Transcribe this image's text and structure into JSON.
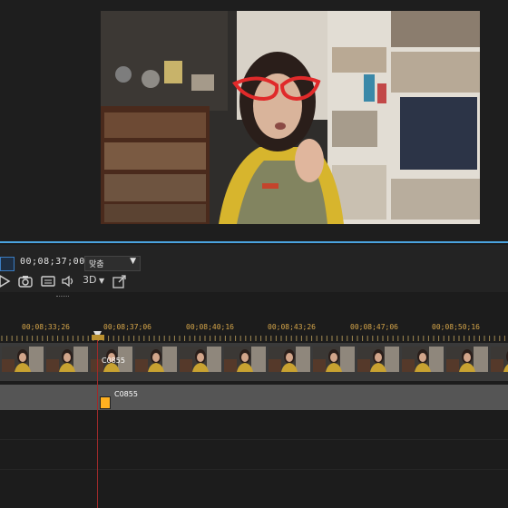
{
  "player": {
    "timecode": "00;08;37;00",
    "fit_label": "맞춤",
    "mode_3d": "3D"
  },
  "icons": [
    "play-icon",
    "camera-icon",
    "subtitle-icon",
    "speaker-icon",
    "external-link-icon",
    "chevron-down-icon"
  ],
  "timeline": {
    "ruler_labels": [
      "00;08;33;26",
      "00;08;37;06",
      "00;08;40;16",
      "00;08;43;26",
      "00;08;47;06",
      "00;08;50;16"
    ],
    "video_clip_label": "C0855",
    "audio_clip_label": "C0855"
  },
  "colors": {
    "accent_blue": "#4aa3df",
    "timecode_gold": "#d6a64a",
    "playhead_red": "#9e2a2a"
  }
}
